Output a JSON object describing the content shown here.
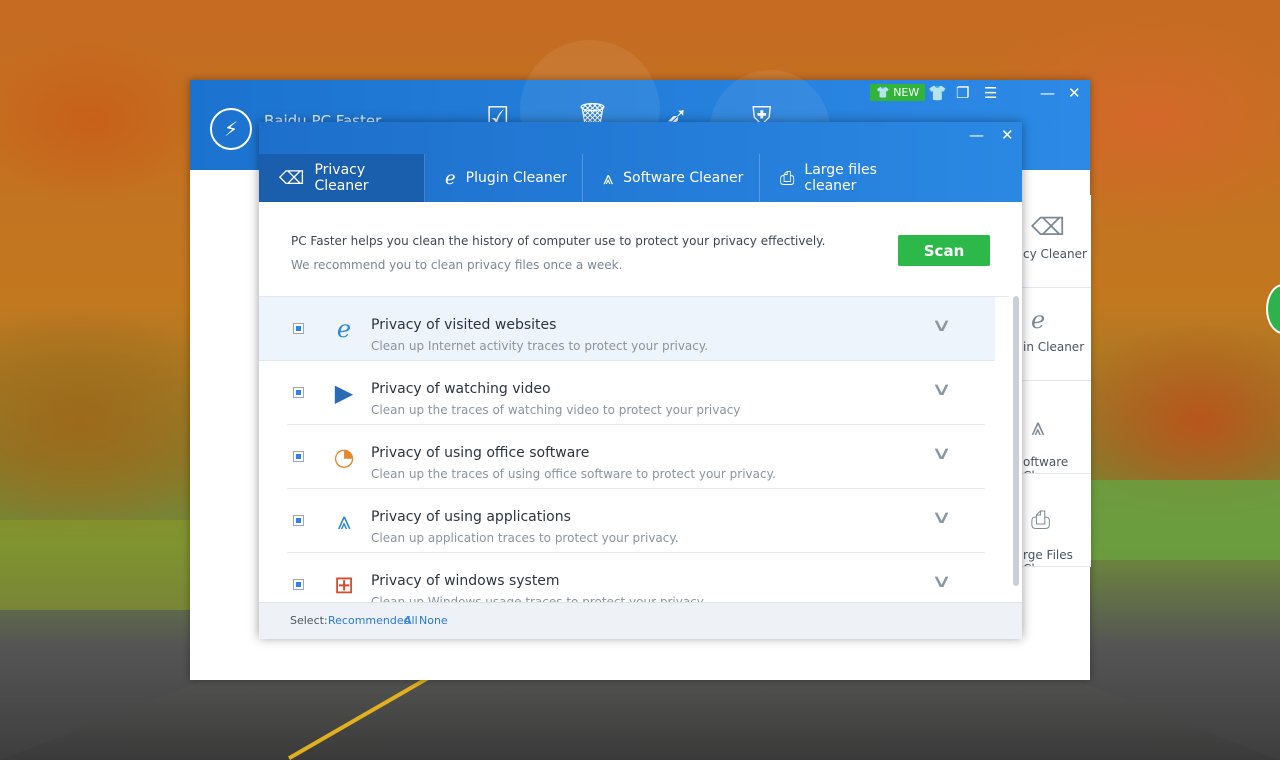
{
  "app": {
    "title": "Baidu PC Faster",
    "new_badge": "NEW"
  },
  "side_panel": {
    "items": [
      {
        "label": "cy Cleaner",
        "icon": "eraser-icon"
      },
      {
        "label": "in Cleaner",
        "icon": "ie-icon"
      },
      {
        "label": "oftware\nCleaner",
        "icon": "appstore-icon"
      },
      {
        "label": "rge Files\nCleaner",
        "icon": "large-files-icon"
      }
    ]
  },
  "dialog": {
    "tabs": [
      {
        "label": "Privacy Cleaner",
        "icon": "eraser-icon",
        "active": true
      },
      {
        "label": "Plugin Cleaner",
        "icon": "ie-icon",
        "active": false
      },
      {
        "label": "Software Cleaner",
        "icon": "appstore-icon",
        "active": false
      },
      {
        "label": "Large files cleaner",
        "icon": "search-file-icon",
        "active": false
      }
    ],
    "intro_line1": "PC Faster helps you clean the history of computer use to protect your privacy effectively.",
    "intro_line2": "We recommend you to clean privacy files once a week.",
    "scan_label": "Scan",
    "items": [
      {
        "title": "Privacy of visited websites",
        "desc": "Clean up Internet activity traces to protect your privacy.",
        "checked": true
      },
      {
        "title": "Privacy of watching video",
        "desc": "Clean up the traces of watching video to protect your privacy",
        "checked": true
      },
      {
        "title": "Privacy of using office software",
        "desc": "Clean up the traces of using office software to protect your privacy.",
        "checked": true
      },
      {
        "title": "Privacy of using applications",
        "desc": "Clean up application traces to protect your privacy.",
        "checked": true
      },
      {
        "title": "Privacy of windows system",
        "desc": "Clean up Windows usage traces to protect your privacy.",
        "checked": true
      }
    ],
    "footer": {
      "select_label": "Select:",
      "recommended": "Recommended",
      "all": "All",
      "none": "None"
    }
  },
  "colors": {
    "accent_blue": "#1d6fcb",
    "scan_green": "#2db84a",
    "link_blue": "#2a7ad6"
  }
}
